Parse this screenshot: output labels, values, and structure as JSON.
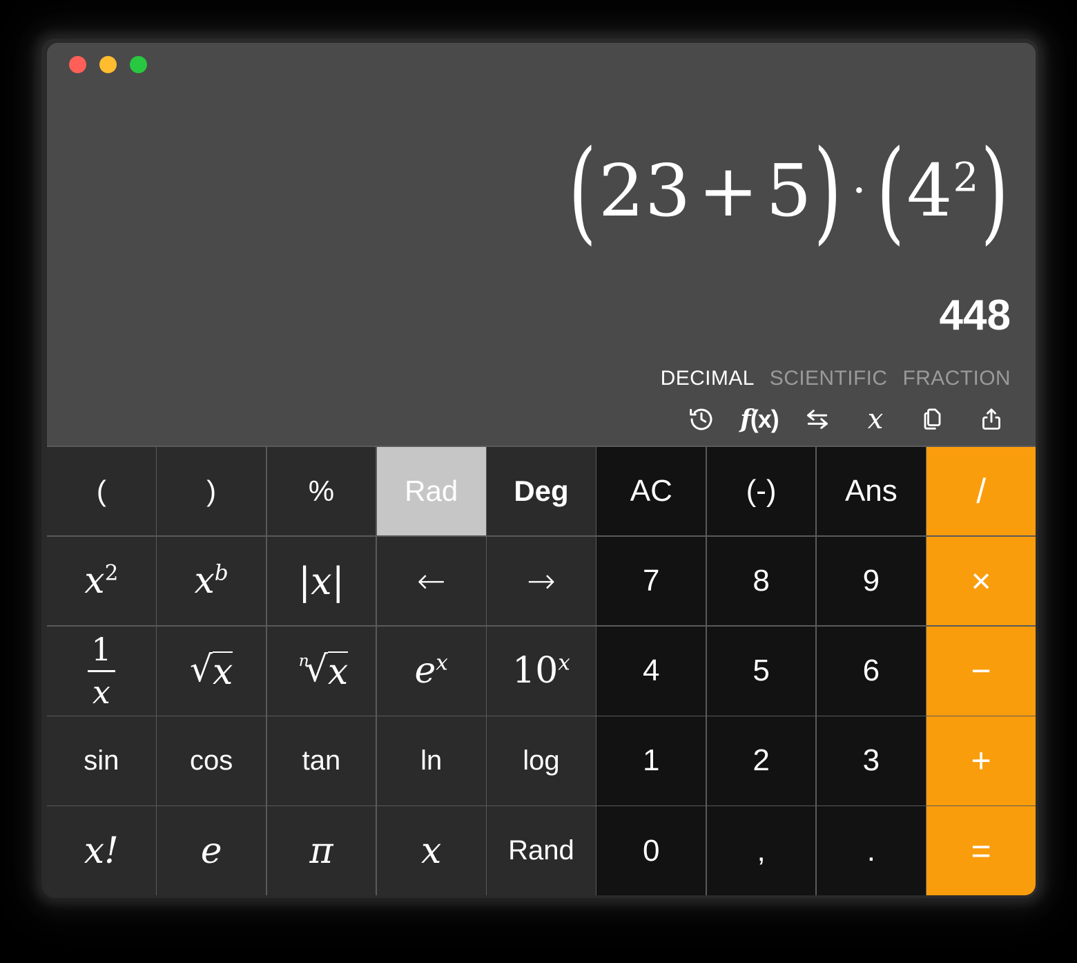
{
  "window": {
    "traffic_lights": [
      {
        "name": "close",
        "color": "#ff5f56"
      },
      {
        "name": "minimize",
        "color": "#febc2e"
      },
      {
        "name": "maximize",
        "color": "#28c840"
      }
    ]
  },
  "display": {
    "expression_text": "(23 + 5) · (4²)",
    "expression_parts": {
      "open1": "(",
      "a": "23",
      "plus": "+",
      "b": "5",
      "close1": ")",
      "mid_dot": "·",
      "open2": "(",
      "base": "4",
      "exponent": "2",
      "close2": ")"
    },
    "result": "448",
    "formats": [
      {
        "label": "DECIMAL",
        "active": true
      },
      {
        "label": "SCIENTIFIC",
        "active": false
      },
      {
        "label": "FRACTION",
        "active": false
      }
    ],
    "tools": [
      {
        "name": "history-icon",
        "label": "History"
      },
      {
        "name": "function-icon",
        "label": "f(x)"
      },
      {
        "name": "convert-icon",
        "label": "Convert"
      },
      {
        "name": "variable-icon",
        "label": "x"
      },
      {
        "name": "copy-icon",
        "label": "Copy"
      },
      {
        "name": "share-icon",
        "label": "Share"
      }
    ]
  },
  "keypad": {
    "rows": [
      [
        {
          "label": "(",
          "name": "open-paren"
        },
        {
          "label": ")",
          "name": "close-paren"
        },
        {
          "label": "%",
          "name": "percent"
        },
        {
          "label": "Rad",
          "name": "rad-mode"
        },
        {
          "label": "Deg",
          "name": "deg-mode"
        },
        {
          "label": "AC",
          "name": "all-clear"
        },
        {
          "label": "(-)",
          "name": "negate"
        },
        {
          "label": "Ans",
          "name": "answer"
        },
        {
          "label": "/",
          "name": "divide"
        }
      ],
      [
        {
          "label": "x²",
          "name": "square"
        },
        {
          "label": "xᵇ",
          "name": "power"
        },
        {
          "label": "|x|",
          "name": "absolute-value"
        },
        {
          "label": "←",
          "name": "cursor-left"
        },
        {
          "label": "→",
          "name": "cursor-right"
        },
        {
          "label": "7",
          "name": "digit-7"
        },
        {
          "label": "8",
          "name": "digit-8"
        },
        {
          "label": "9",
          "name": "digit-9"
        },
        {
          "label": "×",
          "name": "multiply"
        }
      ],
      [
        {
          "label": "1/x",
          "name": "reciprocal"
        },
        {
          "label": "√x",
          "name": "square-root"
        },
        {
          "label": "ⁿ√x",
          "name": "nth-root"
        },
        {
          "label": "eˣ",
          "name": "exp"
        },
        {
          "label": "10ˣ",
          "name": "ten-power"
        },
        {
          "label": "4",
          "name": "digit-4"
        },
        {
          "label": "5",
          "name": "digit-5"
        },
        {
          "label": "6",
          "name": "digit-6"
        },
        {
          "label": "−",
          "name": "subtract"
        }
      ],
      [
        {
          "label": "sin",
          "name": "sine"
        },
        {
          "label": "cos",
          "name": "cosine"
        },
        {
          "label": "tan",
          "name": "tangent"
        },
        {
          "label": "ln",
          "name": "natural-log"
        },
        {
          "label": "log",
          "name": "log"
        },
        {
          "label": "1",
          "name": "digit-1"
        },
        {
          "label": "2",
          "name": "digit-2"
        },
        {
          "label": "3",
          "name": "digit-3"
        },
        {
          "label": "+",
          "name": "add"
        }
      ],
      [
        {
          "label": "x!",
          "name": "factorial"
        },
        {
          "label": "e",
          "name": "euler-number"
        },
        {
          "label": "π",
          "name": "pi"
        },
        {
          "label": "x",
          "name": "variable-x"
        },
        {
          "label": "Rand",
          "name": "random"
        },
        {
          "label": "0",
          "name": "digit-0"
        },
        {
          "label": ",",
          "name": "comma"
        },
        {
          "label": ".",
          "name": "decimal-point"
        },
        {
          "label": "=",
          "name": "equals"
        }
      ]
    ]
  },
  "colors": {
    "display_bg": "#4a4a4a",
    "function_key_bg": "#2b2b2b",
    "number_key_bg": "#121212",
    "operator_bg": "#fa9d0c",
    "active_key_bg": "#c6c6c6",
    "inactive_text": "#9a9a9a"
  }
}
